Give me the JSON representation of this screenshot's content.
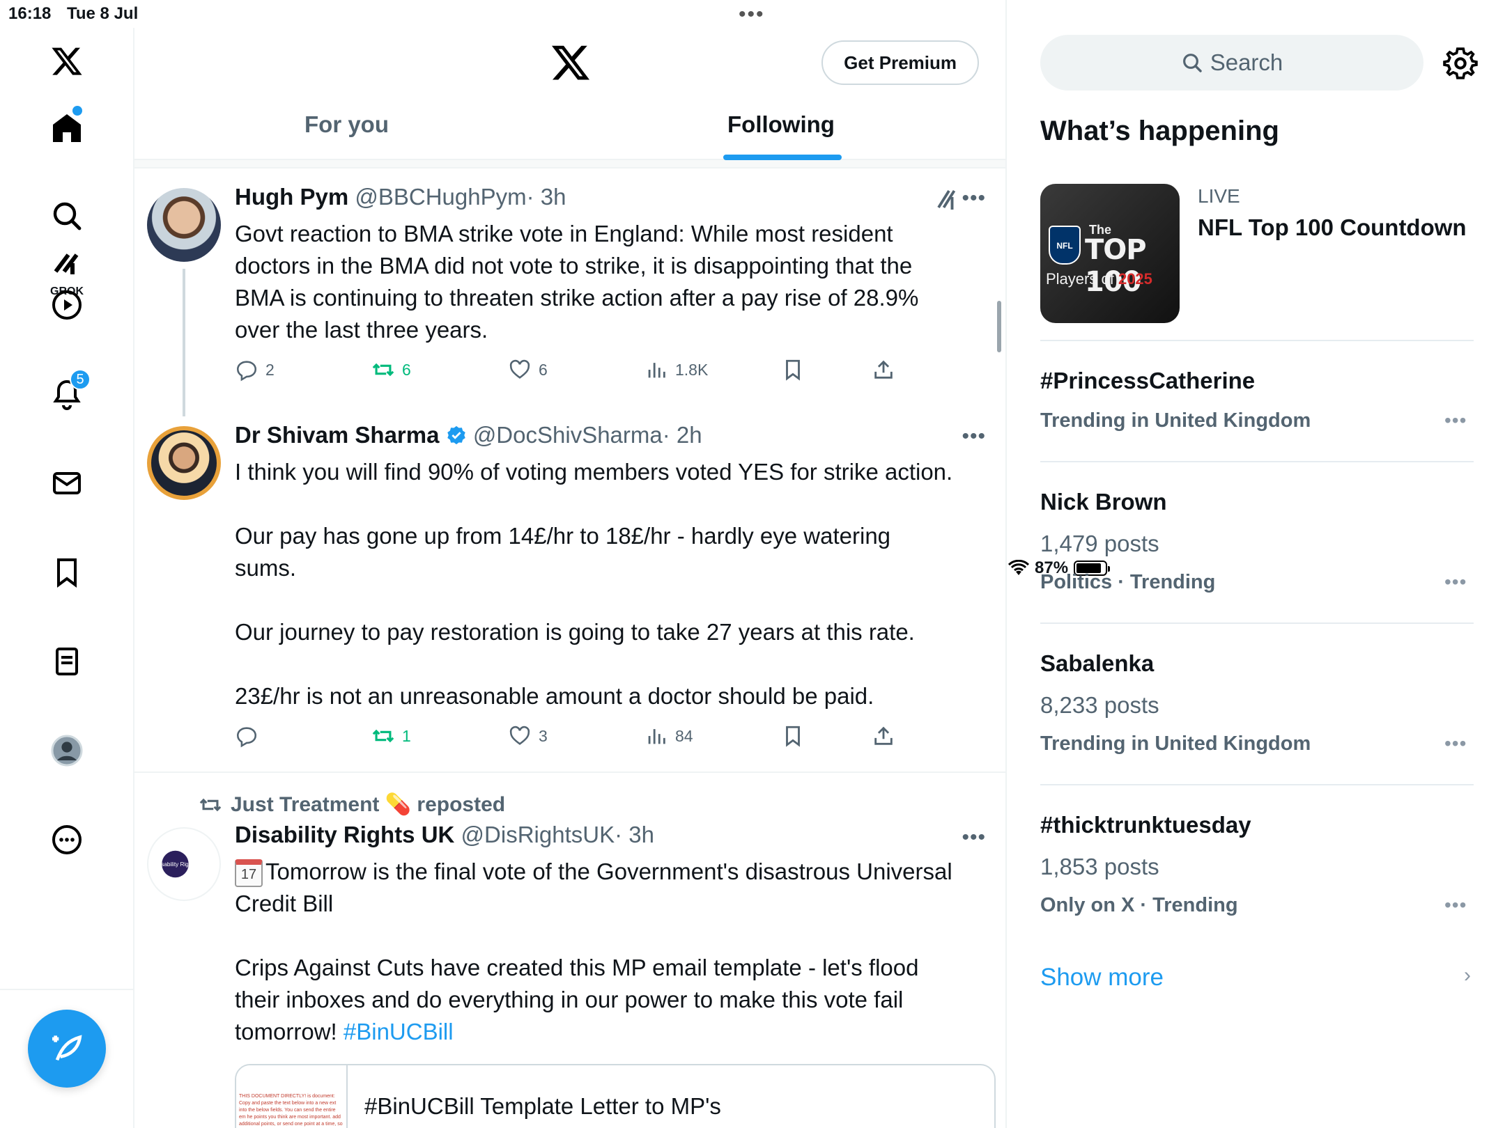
{
  "status_bar": {
    "time": "16:18",
    "date": "Tue 8 Jul",
    "battery": "87%",
    "battery_level": 0.87
  },
  "nav": {
    "notifications_count": "5",
    "grok_label": "GROK"
  },
  "header": {
    "premium_label": "Get Premium",
    "tabs": [
      {
        "label": "For you",
        "active": false
      },
      {
        "label": "Following",
        "active": true
      }
    ]
  },
  "tweets": [
    {
      "name": "Hugh Pym",
      "handle": "@BBCHughPym",
      "time": "· 3h",
      "body": [
        "Govt reaction to BMA strike vote in England: While most resident",
        "doctors in the BMA did not vote to strike, it is disappointing that the",
        "BMA is continuing to threaten strike action after a pay rise of 28.9%",
        "over the last three years."
      ],
      "replies": "2",
      "reposts": "6",
      "likes": "6",
      "views": "1.8K"
    },
    {
      "name": "Dr Shivam Sharma",
      "handle": "@DocShivSharma",
      "time": "· 2h",
      "body": [
        "I think you will find 90% of voting members voted YES for strike action.",
        "",
        "Our pay has gone up from 14£/hr to 18£/hr - hardly eye watering",
        "sums.",
        "",
        "Our journey to pay restoration is going to take 27 years at this rate.",
        "",
        "23£/hr is not an unreasonable amount a doctor should be paid."
      ],
      "replies": "",
      "reposts": "1",
      "likes": "3",
      "views": "84"
    },
    {
      "repost_by": "Just Treatment 💊 reposted",
      "name": "Disability Rights UK",
      "handle": "@DisRightsUK",
      "time": "· 3h",
      "avatar_text": "Disability Rights UK",
      "calendar_day": "17",
      "body_line1": "Tomorrow is the final vote of the Government's disastrous Universal",
      "body_line2": "Credit Bill",
      "body_line3": "Crips Against Cuts have created this MP email template - let's flood",
      "body_line4": "their inboxes and do everything in our power to make this vote fail",
      "body_line5": "tomorrow!",
      "hashtag": "#BinUCBill",
      "card_title": "#BinUCBill Template Letter to MP's",
      "card_thumb_text": "THIS DOCUMENT DIRECTLY! is document: Copy and paste the text below into a new ext into the below fields. You can send the entire em he points you think are most important. add additional points, or send one point at a time, so yo"
    }
  ],
  "sidebar": {
    "search_placeholder": "Search",
    "title": "What’s happening",
    "live": {
      "label": "LIVE",
      "title": "NFL Top 100 Countdown",
      "thumb_the": "The",
      "thumb_top": "TOP 100",
      "thumb_players": "Players of",
      "thumb_year": "2025",
      "thumb_nfl": "NFL"
    },
    "trends": [
      {
        "name": "#PrincessCatherine",
        "posts": "",
        "meta": "Trending in United Kingdom"
      },
      {
        "name": "Nick Brown",
        "posts": "1,479 posts",
        "meta": "Politics · Trending"
      },
      {
        "name": "Sabalenka",
        "posts": "8,233 posts",
        "meta": "Trending in United Kingdom"
      },
      {
        "name": "#thicktrunktuesday",
        "posts": "1,853 posts",
        "meta": "Only on X · Trending"
      }
    ],
    "show_more": "Show more"
  },
  "colors": {
    "accent": "#1d9bf0",
    "repost_green": "#00ba7c",
    "muted": "#536471"
  }
}
